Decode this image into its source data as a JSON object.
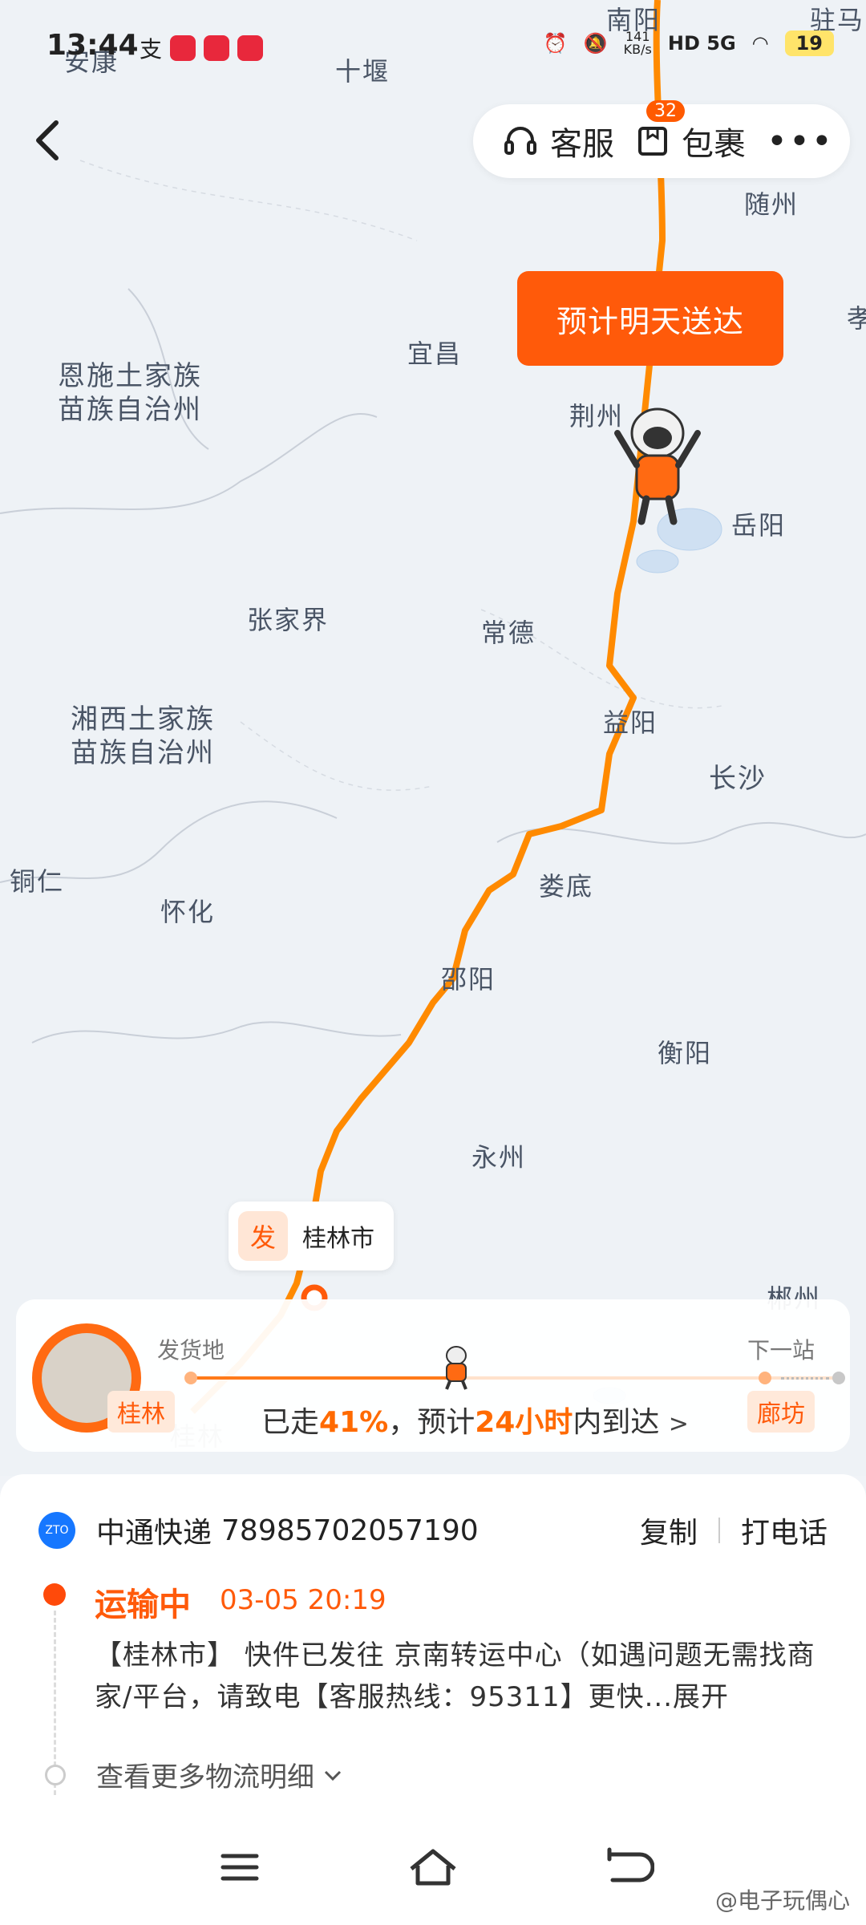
{
  "status_bar": {
    "time": "13:44",
    "alipay_glyph": "支",
    "net_speed": "141\nKB/s",
    "signal": "HD 5G",
    "battery": "19"
  },
  "top_bar": {
    "service_label": "客服",
    "package_label": "包裹",
    "package_badge": "32",
    "more_label": "•••"
  },
  "map": {
    "cities": [
      {
        "name": "南阳"
      },
      {
        "name": "驻马"
      },
      {
        "name": "安康"
      },
      {
        "name": "十堰"
      },
      {
        "name": "随州"
      },
      {
        "name": "孝"
      },
      {
        "name": "宜昌"
      },
      {
        "name": "荆州"
      },
      {
        "name": "恩施土家族\n苗族自治州"
      },
      {
        "name": "岳阳"
      },
      {
        "name": "张家界"
      },
      {
        "name": "常德"
      },
      {
        "name": "益阳"
      },
      {
        "name": "湘西土家族\n苗族自治州"
      },
      {
        "name": "长沙"
      },
      {
        "name": "铜仁"
      },
      {
        "name": "怀化"
      },
      {
        "name": "娄底"
      },
      {
        "name": "邵阳"
      },
      {
        "name": "衡阳"
      },
      {
        "name": "永州"
      },
      {
        "name": "郴州"
      },
      {
        "name": "桂林"
      }
    ],
    "route_color": "#ff8a00",
    "eta_bubble": "预计明天送达"
  },
  "origin_marker": {
    "tag": "发",
    "name": "桂林市"
  },
  "progress": {
    "from_label": "发货地",
    "next_label": "下一站",
    "from_city": "桂林",
    "next_city": "廊坊",
    "progress_fraction": 0.41,
    "text_prefix": "已走",
    "percent": "41%",
    "text_mid": "，预计",
    "hours": "24小时",
    "text_suffix": "内到达",
    "chevron": ">"
  },
  "shipment": {
    "carrier": "中通快递",
    "tracking_number": "78985702057190",
    "copy_label": "复制",
    "call_label": "打电话",
    "status": "运输中",
    "status_time": "03-05 20:19",
    "detail": "【桂林市】 快件已发往 京南转运中心（如遇问题无需找商家/平台，请致电【客服热线：95311】更快...展开",
    "more_logs": "查看更多物流明细"
  },
  "watermark": "@电子玩偶心",
  "accent_color": "#ff5a0a"
}
